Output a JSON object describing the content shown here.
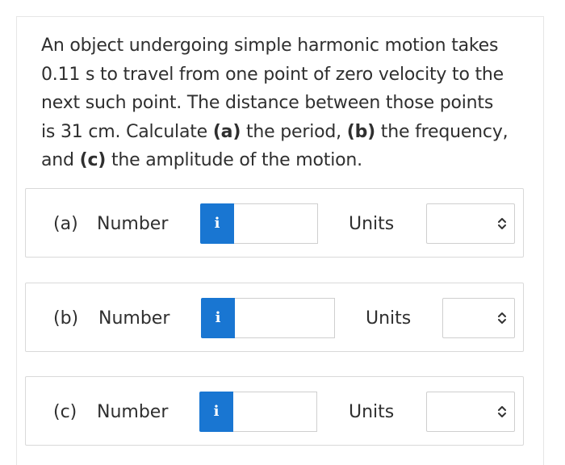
{
  "question": {
    "line1": "An object undergoing simple harmonic motion takes",
    "line2": "0.11 s to travel from one point of zero velocity to the",
    "line3": "next such point. The distance between those points",
    "line4_pre": "is 31 cm. Calculate ",
    "part_a_marker": "(a)",
    "line4_mid": " the period, ",
    "part_b_marker": "(b)",
    "line4_post": " the frequency,",
    "line5_pre": "and ",
    "part_c_marker": "(c)",
    "line5_post": " the amplitude of the motion."
  },
  "answers": [
    {
      "part_label": "(a)",
      "number_label": "Number",
      "info_label": "i",
      "number_value": "",
      "units_label": "Units",
      "units_value": ""
    },
    {
      "part_label": "(b)",
      "number_label": "Number",
      "info_label": "i",
      "number_value": "",
      "units_label": "Units",
      "units_value": ""
    },
    {
      "part_label": "(c)",
      "number_label": "Number",
      "info_label": "i",
      "number_value": "",
      "units_label": "Units",
      "units_value": ""
    }
  ],
  "colors": {
    "info_button": "#1976d2",
    "text": "#2f2f2f",
    "border": "#d9d9d9"
  },
  "icons": {
    "info": "info-icon",
    "select_arrows": "chevron-up-down-icon"
  }
}
